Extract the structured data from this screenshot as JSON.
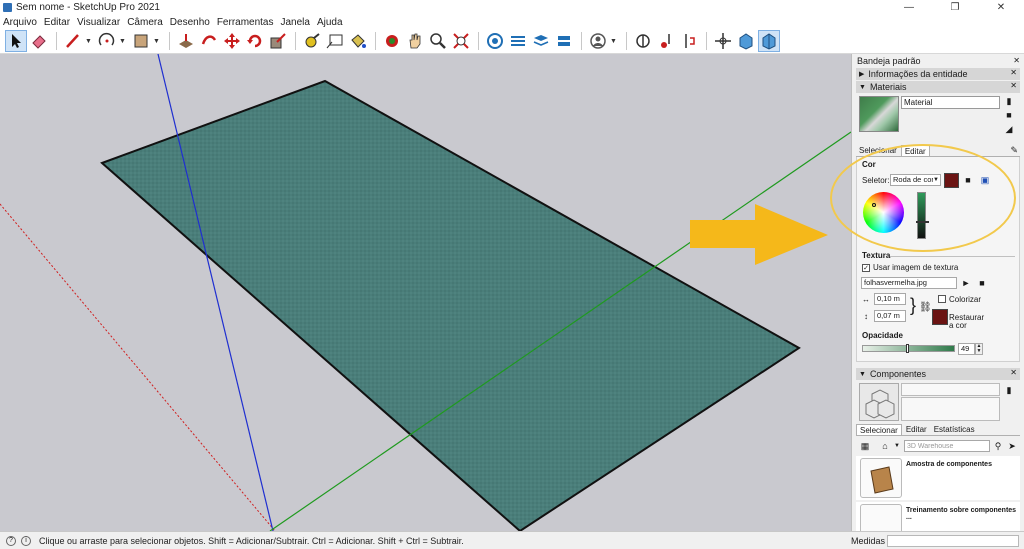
{
  "window": {
    "title": "Sem nome - SketchUp Pro 2021"
  },
  "menu": [
    "Arquivo",
    "Editar",
    "Visualizar",
    "Câmera",
    "Desenho",
    "Ferramentas",
    "Janela",
    "Ajuda"
  ],
  "toolbar": {
    "tools": [
      "select-tool",
      "eraser-tool",
      "line-tool",
      "arc-tool",
      "shape-tool",
      "push-pull-tool",
      "follow-me-tool",
      "move-tool",
      "rotate-tool",
      "scale-tool",
      "tape-measure-tool",
      "text-tool",
      "paint-bucket-tool",
      "orbit-tool",
      "pan-tool",
      "zoom-tool",
      "zoom-extents-tool",
      "3d-warehouse-tool",
      "extension-warehouse-tool",
      "layout-tool",
      "extension-manager-tool",
      "account-tool",
      "section-plane-tool",
      "display-section-planes-tool",
      "section-cuts-tool",
      "position-camera-tool",
      "walk-tool",
      "look-around-tool"
    ]
  },
  "tray": {
    "title": "Bandeja padrão",
    "entity_info": {
      "label": "Informações da entidade"
    },
    "materials": {
      "label": "Materiais",
      "name_value": "Material",
      "tabs": [
        "Selecionar",
        "Editar"
      ],
      "active_tab": "Editar",
      "color_section": "Cor",
      "selector_label": "Seletor:",
      "selector_value": "Roda de cores",
      "texture_section": "Textura",
      "use_texture_label": "Usar imagem de textura",
      "use_texture_checked": true,
      "texture_file": "folhasvermelha.jpg",
      "width_value": "0,10 m",
      "height_value": "0,07 m",
      "colorize_label": "Colorizar",
      "restore_label": "Restaurar a cor",
      "opacity_label": "Opacidade",
      "opacity_value": "49",
      "swatch_color": "#6b1413"
    },
    "components": {
      "label": "Componentes",
      "tabs": [
        "Selecionar",
        "Editar",
        "Estatísticas"
      ],
      "search_placeholder": "3D Warehouse",
      "items": [
        "Amostra de componentes",
        "Treinamento sobre componentes ..."
      ]
    }
  },
  "status": {
    "hint": "Clique ou arraste para selecionar objetos. Shift = Adicionar/Subtrair. Ctrl = Adicionar. Shift + Ctrl = Subtrair.",
    "measure_label": "Medidas"
  },
  "colors": {
    "viewport_bg": "#c9c9cf",
    "plane_fill": "#4a7e7a",
    "highlight_ring": "#f2c94c",
    "arrow": "#f5b81a",
    "axis_blue": "#1f2fd0",
    "axis_green": "#1f9a1f",
    "axis_red": "#d01f1f"
  }
}
